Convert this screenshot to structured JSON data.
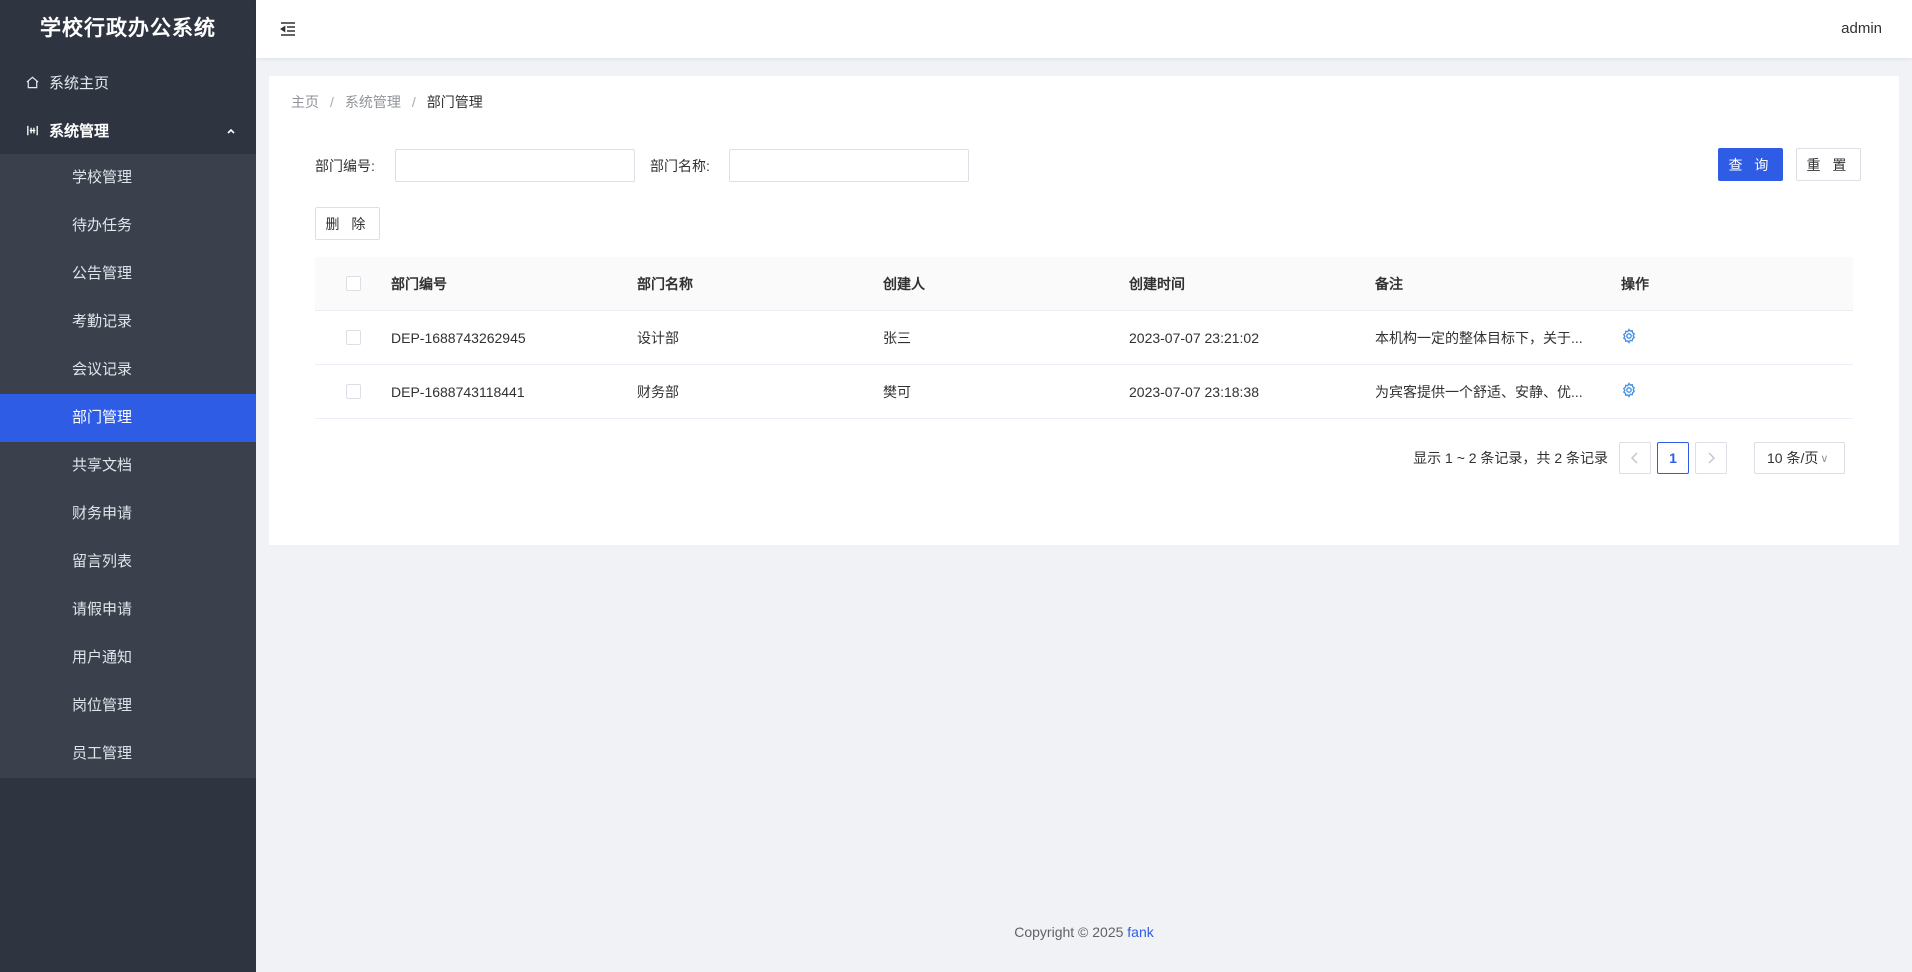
{
  "app": {
    "title": "学校行政办公系统"
  },
  "sidebar": {
    "home": {
      "label": "系统主页"
    },
    "group": {
      "label": "系统管理"
    },
    "items": [
      {
        "label": "学校管理",
        "active": false
      },
      {
        "label": "待办任务",
        "active": false
      },
      {
        "label": "公告管理",
        "active": false
      },
      {
        "label": "考勤记录",
        "active": false
      },
      {
        "label": "会议记录",
        "active": false
      },
      {
        "label": "部门管理",
        "active": true
      },
      {
        "label": "共享文档",
        "active": false
      },
      {
        "label": "财务申请",
        "active": false
      },
      {
        "label": "留言列表",
        "active": false
      },
      {
        "label": "请假申请",
        "active": false
      },
      {
        "label": "用户通知",
        "active": false
      },
      {
        "label": "岗位管理",
        "active": false
      },
      {
        "label": "员工管理",
        "active": false
      }
    ]
  },
  "header": {
    "user": "admin"
  },
  "breadcrumb": {
    "home": "主页",
    "section": "系统管理",
    "current": "部门管理",
    "separator": "/"
  },
  "search": {
    "code_label": "部门编号:",
    "code_value": "",
    "name_label": "部门名称:",
    "name_value": "",
    "query_button": "查 询",
    "reset_button": "重 置"
  },
  "toolbar": {
    "delete_button": "删 除"
  },
  "table": {
    "columns": [
      "部门编号",
      "部门名称",
      "创建人",
      "创建时间",
      "备注",
      "操作"
    ],
    "rows": [
      {
        "code": "DEP-1688743262945",
        "name": "设计部",
        "creator": "张三",
        "created": "2023-07-07 23:21:02",
        "remark": "本机构一定的整体目标下，关于..."
      },
      {
        "code": "DEP-1688743118441",
        "name": "财务部",
        "creator": "樊可",
        "created": "2023-07-07 23:18:38",
        "remark": "为宾客提供一个舒适、安静、优..."
      }
    ]
  },
  "pagination": {
    "summary": "显示 1 ~ 2 条记录，共 2 条记录",
    "current_page": "1",
    "page_size": "10 条/页"
  },
  "footer": {
    "copyright": "Copyright © 2025",
    "author": "fank"
  },
  "colors": {
    "primary": "#2e5ce5",
    "sidebar_bg": "#2f3540",
    "submenu_bg": "#3a414d",
    "icon_blue": "#3f8ee0"
  },
  "icons": {
    "home": "home-icon",
    "group": "settings-sliders-icon",
    "collapse": "chevron-up-icon",
    "menu_toggle": "indent-menu-icon",
    "row_action": "gear-icon",
    "prev": "chevron-left-icon",
    "next": "chevron-right-icon"
  }
}
